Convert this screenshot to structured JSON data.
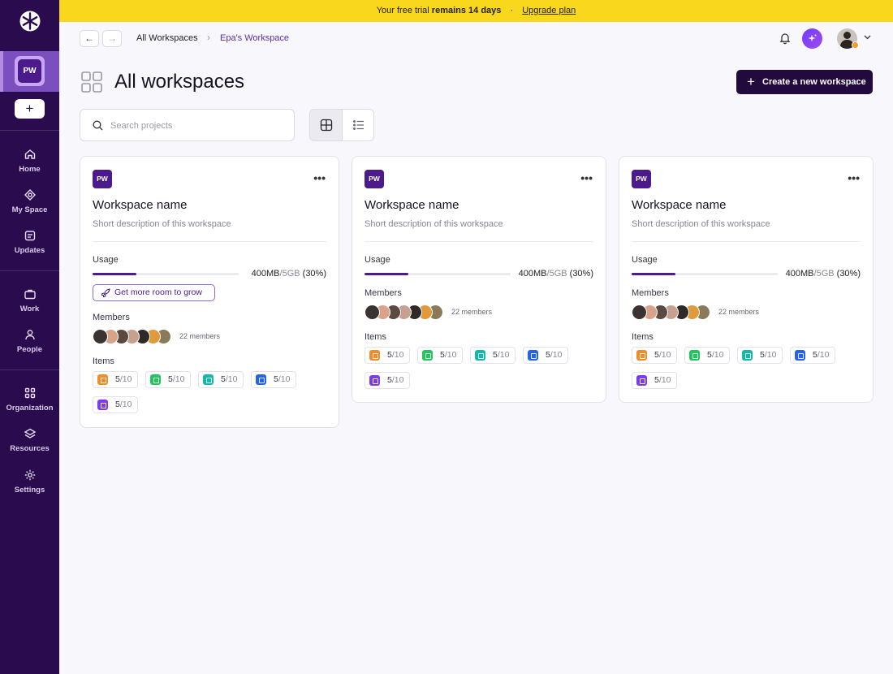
{
  "banner": {
    "prefix": "Your free trial",
    "bold": "remains 14 days",
    "separator": "·",
    "link": "Upgrade plan"
  },
  "sidebar": {
    "workspace_initials": "PW",
    "add_label": "+",
    "items": [
      {
        "label": "Home",
        "icon": "home-icon"
      },
      {
        "label": "My Space",
        "icon": "my-space-icon"
      },
      {
        "label": "Updates",
        "icon": "updates-icon"
      },
      {
        "label": "Work",
        "icon": "briefcase-icon"
      },
      {
        "label": "People",
        "icon": "people-icon"
      },
      {
        "label": "Organization",
        "icon": "grid-icon"
      },
      {
        "label": "Resources",
        "icon": "layers-icon"
      },
      {
        "label": "Settings",
        "icon": "gear-icon"
      }
    ]
  },
  "topbar": {
    "back": "←",
    "forward": "→",
    "breadcrumb": [
      "All Workspaces",
      "Epa's Workspace"
    ],
    "separator": "›"
  },
  "header": {
    "title": "All workspaces",
    "create_label": "Create a new workspace",
    "create_plus": "+"
  },
  "search": {
    "placeholder": "Search projects"
  },
  "view_toggle": {
    "active": "grid"
  },
  "colors": {
    "sidebar": "#2a0b4d",
    "banner": "#f9d71c",
    "accent": "#4b1b8c",
    "item_colors": [
      "#f28c28",
      "#22c55e",
      "#14b8a6",
      "#2563eb",
      "#7c3aed"
    ]
  },
  "cards": [
    {
      "initials": "PW",
      "menu": "•••",
      "name": "Workspace name",
      "description": "Short description of this workspace",
      "usage_label": "Usage",
      "usage_used": "400MB",
      "usage_sep": "/",
      "usage_total": "5GB",
      "usage_pct_text": "(30%)",
      "usage_fraction": 0.3,
      "grow_label": "Get more room to grow",
      "members_label": "Members",
      "members_count": "22 members",
      "items_label": "Items",
      "items": [
        {
          "value": "5",
          "max": "/10"
        },
        {
          "value": "5",
          "max": "/10"
        },
        {
          "value": "5",
          "max": "/10"
        },
        {
          "value": "5",
          "max": "/10"
        },
        {
          "value": "5",
          "max": "/10"
        }
      ]
    },
    {
      "initials": "PW",
      "menu": "•••",
      "name": "Workspace name",
      "description": "Short description of this workspace",
      "usage_label": "Usage",
      "usage_used": "400MB",
      "usage_sep": "/",
      "usage_total": "5GB",
      "usage_pct_text": "(30%)",
      "usage_fraction": 0.3,
      "members_label": "Members",
      "members_count": "22 members",
      "items_label": "Items",
      "items": [
        {
          "value": "5",
          "max": "/10"
        },
        {
          "value": "5",
          "max": "/10"
        },
        {
          "value": "5",
          "max": "/10"
        },
        {
          "value": "5",
          "max": "/10"
        },
        {
          "value": "5",
          "max": "/10"
        }
      ]
    },
    {
      "initials": "PW",
      "menu": "•••",
      "name": "Workspace name",
      "description": "Short description of this workspace",
      "usage_label": "Usage",
      "usage_used": "400MB",
      "usage_sep": "/",
      "usage_total": "5GB",
      "usage_pct_text": "(30%)",
      "usage_fraction": 0.3,
      "members_label": "Members",
      "members_count": "22 members",
      "items_label": "Items",
      "items": [
        {
          "value": "5",
          "max": "/10"
        },
        {
          "value": "5",
          "max": "/10"
        },
        {
          "value": "5",
          "max": "/10"
        },
        {
          "value": "5",
          "max": "/10"
        },
        {
          "value": "5",
          "max": "/10"
        }
      ]
    }
  ]
}
